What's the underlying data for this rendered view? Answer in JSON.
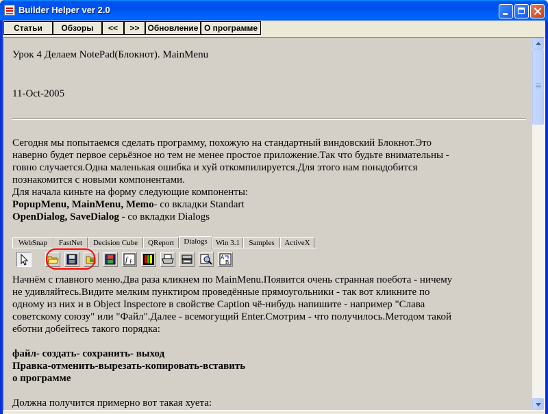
{
  "window": {
    "title": "Builder Helper ver 2.0"
  },
  "nav": {
    "articles": "Статьи",
    "reviews": "Обзоры",
    "prev": "<<",
    "next": ">>",
    "update": "Обновление",
    "about": "О программе"
  },
  "article": {
    "heading": "Урок 4 Делаем NotePad(Блокнот). MainMenu",
    "date": "11-Oct-2005",
    "p1": [
      "Сегодня мы попытаемся сделать программу, похожую на стандартный виндовский Блокнот.Это",
      "наверно будет первое серьёзное но тем не менее простое приложение.Так что будьте внимательны -",
      "говно случается.Одна маленькая ошибка и хуй откомпилируется.Для этого нам понадобится",
      "познакомится с новыми компонентами.",
      "Для начала киньте на форму следующие компоненты:"
    ],
    "components1_bold": "PopupMenu, MainMenu, Memo",
    "components1_rest": "- со вкладки Standart",
    "components2_bold": "OpenDialog, SaveDialog",
    "components2_rest": " - со вкладки Dialogs",
    "p2": [
      "Начнём с главного меню.Два раза кликнем по MainMenu.Появится очень странная поебота - ничему",
      "не удивляйтесь.Видите мелким пунктиром проведённые прямоугольники - так вот кликните по",
      "одному из них и в Object Inspectore в свойстве Caption чё-нибудь напишите - например \"Слава",
      "советскому союзу\" или \"Файл\".Далее - всемогущий Enter.Смотрим - что получилось.Методом такой",
      "еботни добейтесь такого порядка:"
    ],
    "menu_lines": [
      "файл- создать- сохранить- выход",
      "Правка-отменить-вырезать-копировать-вставить",
      "о программе"
    ],
    "last_line": "Должна получится примерно вот такая хуета:"
  },
  "palette": {
    "tabs": [
      "WebSnap",
      "FastNet",
      "Decision Cube",
      "QReport",
      "Dialogs",
      "Win 3.1",
      "Samples",
      "ActiveX"
    ],
    "active_tab": "Dialogs",
    "icons": [
      "pointer-icon",
      "open-dialog-icon",
      "save-dialog-icon",
      "open-picture-dialog-icon",
      "save-picture-dialog-icon",
      "font-dialog-icon",
      "color-dialog-icon",
      "print-dialog-icon",
      "printer-setup-dialog-icon",
      "find-dialog-icon",
      "replace-dialog-icon"
    ],
    "highlight_color": "#ff0000"
  }
}
